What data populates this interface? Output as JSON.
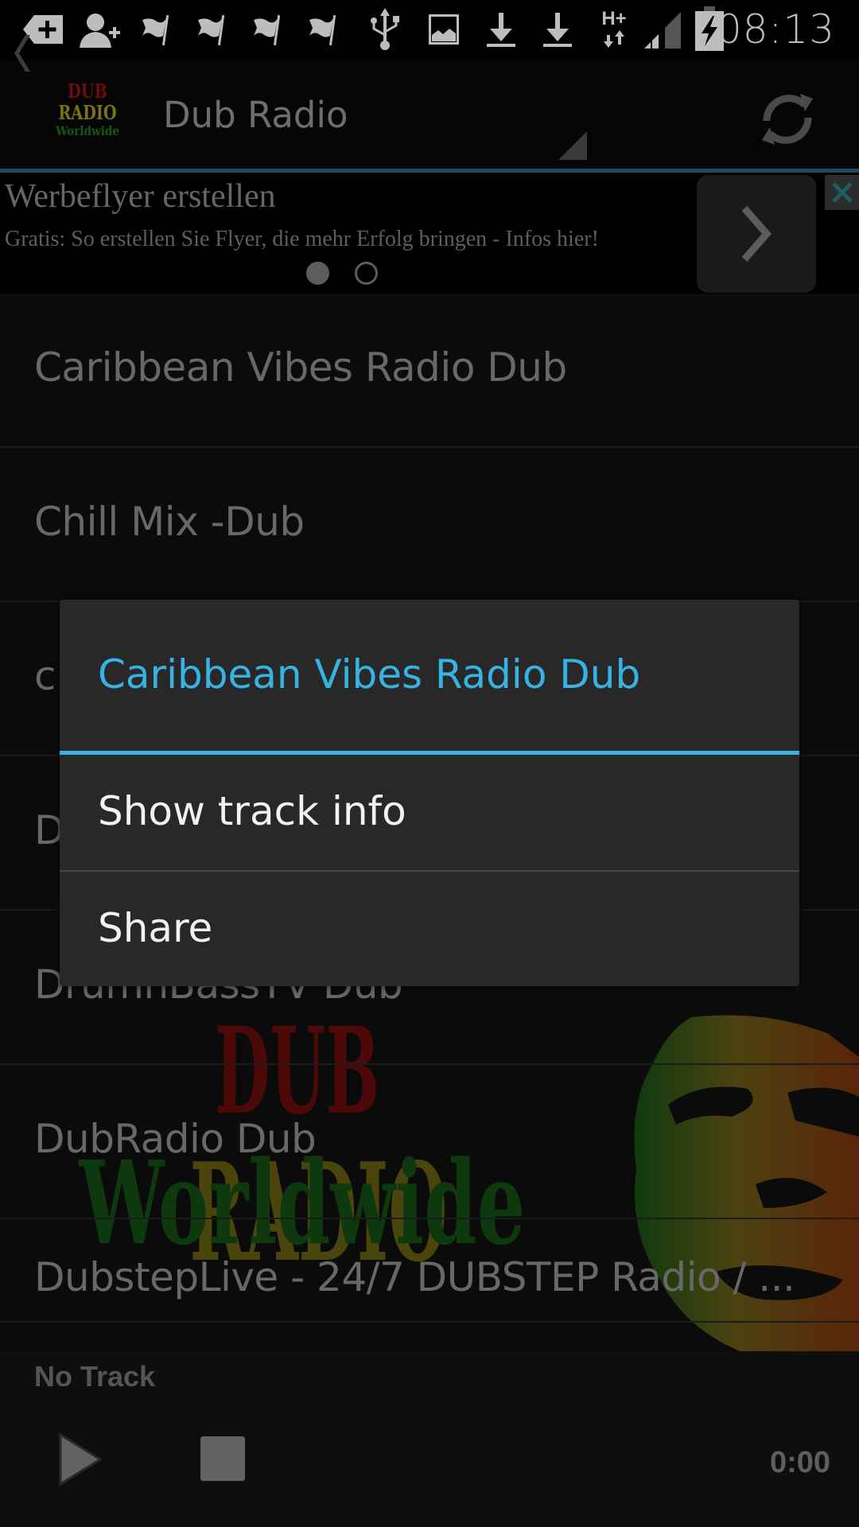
{
  "status_bar": {
    "time": "08:13",
    "icons": [
      "add-tag-icon",
      "add-contact-icon",
      "flag-icon",
      "flag-icon",
      "flag-icon",
      "flag-icon",
      "usb-icon",
      "image-icon",
      "download-icon",
      "download-icon",
      "hplus-data-icon",
      "signal-icon",
      "battery-charging-icon"
    ],
    "network_label": "H+"
  },
  "action_bar": {
    "logo_lines": [
      "DUB",
      "RADIO",
      "Worldwide"
    ],
    "title": "Dub Radio",
    "back_icon": "chevron-left-icon",
    "refresh_icon": "refresh-icon"
  },
  "ad_banner": {
    "title": "Werbeflyer erstellen",
    "description": "Gratis: So erstellen Sie Flyer, die mehr Erfolg bringen - Infos hier!",
    "pages": 2,
    "active_page": 1
  },
  "station_list": {
    "items": [
      {
        "label": "Caribbean Vibes Radio Dub"
      },
      {
        "label": "Chill Mix -Dub"
      },
      {
        "label": "c"
      },
      {
        "label": "D"
      },
      {
        "label": "DrumnBassTV Dub"
      },
      {
        "label": "DubRadio  Dub"
      },
      {
        "label": "DubstepLive - 24/7 DUBSTEP Radio / ..."
      }
    ]
  },
  "background_art": {
    "words": [
      "DUB",
      "RADIO",
      "Worldwide"
    ],
    "colors": {
      "red": "#5a0a0a",
      "yellow": "#4e4a0c",
      "green": "#0e3a0e"
    }
  },
  "player": {
    "track": "No Track",
    "time": "0:00"
  },
  "context_dialog": {
    "title": "Caribbean Vibes Radio Dub",
    "items": [
      {
        "label": "Show track info"
      },
      {
        "label": "Share"
      }
    ],
    "accent_color": "#36b3e2"
  }
}
